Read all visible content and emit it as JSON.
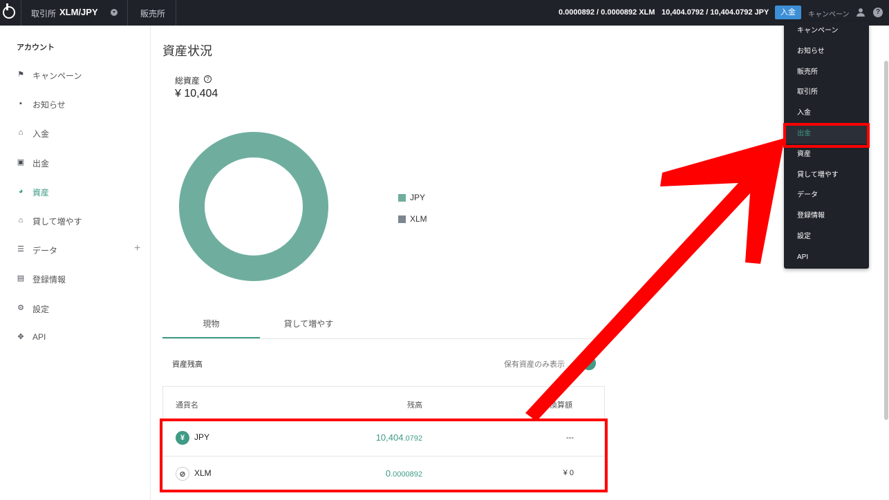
{
  "topbar": {
    "exchange_label": "取引所",
    "pair": "XLM/JPY",
    "store_label": "販売所",
    "xlm_rate": "0.0000892 / 0.0000892 XLM",
    "jpy_rate": "10,404.0792 / 10,404.0792 JPY",
    "deposit_button": "入金",
    "campaign": "キャンペーン",
    "help": "?"
  },
  "sidebar": {
    "title": "アカウント",
    "items": [
      {
        "label": "キャンペーン",
        "icon": "flag-icon"
      },
      {
        "label": "お知らせ",
        "icon": "message-icon"
      },
      {
        "label": "入金",
        "icon": "bank-icon"
      },
      {
        "label": "出金",
        "icon": "wallet-icon"
      },
      {
        "label": "資産",
        "icon": "pie-chart-icon",
        "active": true
      },
      {
        "label": "貸して増やす",
        "icon": "bank-icon"
      },
      {
        "label": "データ",
        "icon": "database-icon",
        "expand": "+"
      },
      {
        "label": "登録情報",
        "icon": "id-card-icon"
      },
      {
        "label": "設定",
        "icon": "gear-icon"
      },
      {
        "label": "API",
        "icon": "move-icon"
      }
    ]
  },
  "main": {
    "title": "資産状況",
    "total_label": "総資産",
    "total_value": "¥ 10,404",
    "legend": [
      {
        "label": "JPY",
        "color": "#6fae9f"
      },
      {
        "label": "XLM",
        "color": "#7d868f"
      }
    ],
    "tabs": [
      {
        "label": "現物",
        "active": true
      },
      {
        "label": "貸して増やす"
      }
    ],
    "balance_title": "資産残高",
    "holdings_only_label": "保有資産のみ表示",
    "table": {
      "headers": [
        "通貨名",
        "残高",
        "円換算額"
      ],
      "rows": [
        {
          "coin": "JPY",
          "icon_glyph": "¥",
          "balance_main": "10,404",
          "balance_small": ".0792",
          "conversion": "---"
        },
        {
          "coin": "XLM",
          "icon_glyph": "⊘",
          "balance_main": "0",
          "balance_small": ".0000892",
          "conversion": "¥ 0"
        }
      ]
    }
  },
  "dropdown": {
    "items": [
      "キャンペーン",
      "お知らせ",
      "販売所",
      "取引所",
      "入金",
      "出金",
      "資産",
      "貸して増やす",
      "データ",
      "登録情報",
      "設定",
      "API"
    ],
    "highlighted": "出金"
  },
  "chart_data": {
    "type": "pie",
    "categories": [
      "JPY",
      "XLM"
    ],
    "values": [
      10404,
      0
    ],
    "colors": [
      "#6fae9f",
      "#7d868f"
    ],
    "legend": "right"
  },
  "colors": {
    "accent": "#3f9b86",
    "topbar": "#1f2229",
    "annotation": "#ff0000",
    "deposit_button": "#3d8fd6"
  }
}
